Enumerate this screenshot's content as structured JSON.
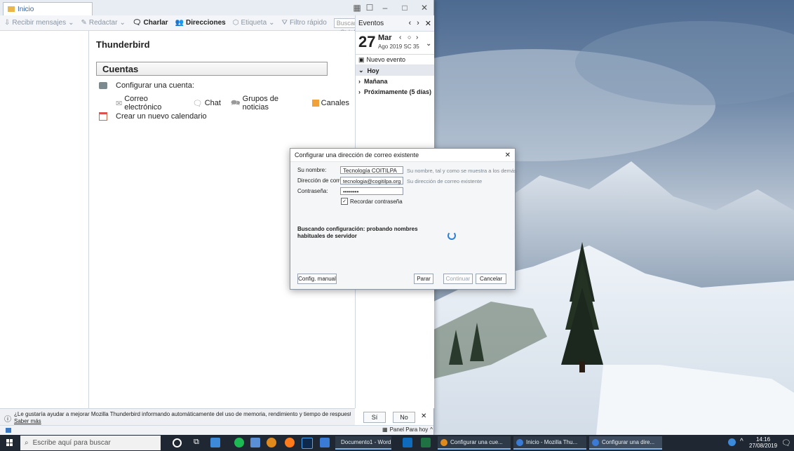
{
  "window": {
    "tab_title": "Inicio"
  },
  "toolbar": {
    "get_mail": "Recibir mensajes",
    "write": "Redactar",
    "chat": "Charlar",
    "address_book": "Direcciones",
    "tag": "Etiqueta",
    "quick_filter": "Filtro rápido",
    "search_placeholder": "Buscar <Ctrl+K>"
  },
  "main": {
    "title": "Thunderbird",
    "accounts_header": "Cuentas",
    "setup_account": "Configurar una cuenta:",
    "account_types": [
      "Correo electrónico",
      "Chat",
      "Grupos de noticias",
      "Canales"
    ],
    "create_calendar": "Crear un nuevo calendario"
  },
  "events": {
    "title": "Eventos",
    "day_number": "27",
    "day_name": "Mar",
    "month_year_week": "Ago 2019 SC 35",
    "new_event": "Nuevo evento",
    "items": [
      "Hoy",
      "Mañana",
      "Próximamente (5 días)"
    ]
  },
  "notification": {
    "text": "¿Le gustaría ayudar a mejorar Mozilla Thunderbird informando automáticamente del uso de memoria, rendimiento y tiempo de respuesta a Mozilla?",
    "learn_more": "Saber más",
    "yes": "Sí",
    "no": "No"
  },
  "status": {
    "today_pane": "Panel Para hoy"
  },
  "dialog": {
    "title": "Configurar una dirección de correo existente",
    "name_label": "Su nombre:",
    "name_value": "Tecnología COITILPA",
    "name_hint": "Su nombre, tal y como se muestra a los demás",
    "email_label": "Dirección de correo:",
    "email_value": "tecnologia@cogitilpa.org",
    "email_hint": "Su dirección de correo existente",
    "password_label": "Contraseña:",
    "password_value": "••••••••",
    "remember_password": "Recordar contraseña",
    "status_text": "Buscando configuración: probando nombres habituales de servidor",
    "manual_config": "Config. manual",
    "stop": "Parar",
    "continue": "Continuar",
    "cancel": "Cancelar"
  },
  "taskbar": {
    "search_placeholder": "Escribe aquí para buscar",
    "apps": [
      "Documento1 - Word",
      "Configurar una cue...",
      "Inicio - Mozilla Thu...",
      "Configurar una dire..."
    ],
    "time": "14:16",
    "date": "27/08/2019"
  }
}
